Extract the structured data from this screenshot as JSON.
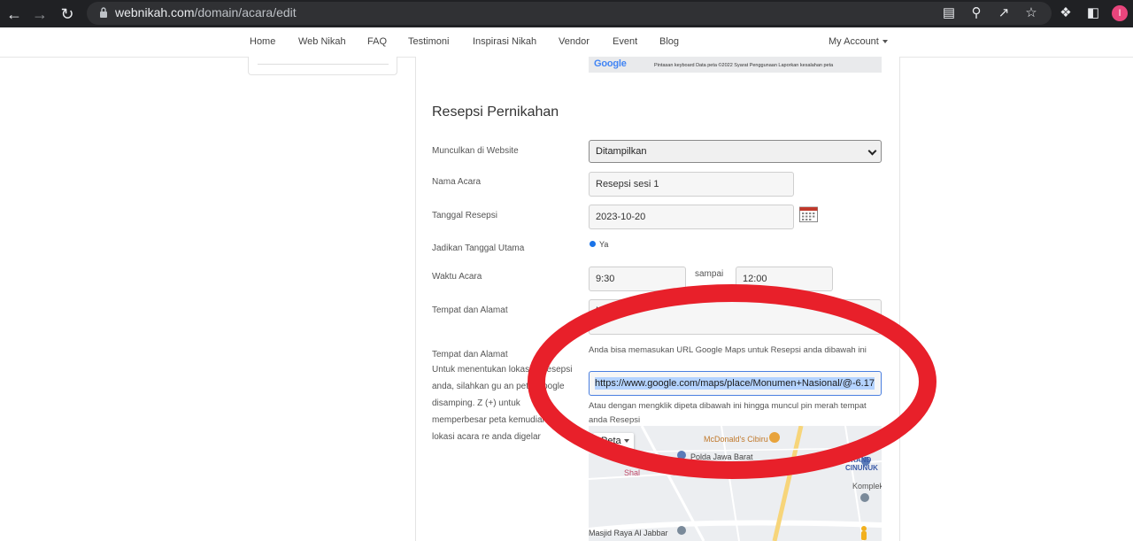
{
  "browser": {
    "url_domain": "webnikah.com",
    "url_path": "/domain/acara/edit",
    "profile_initial": "I",
    "profile_color": "#e8457c"
  },
  "navbar": {
    "items": [
      {
        "label": "Home"
      },
      {
        "label": "Web Nikah"
      },
      {
        "label": "FAQ"
      },
      {
        "label": "Testimoni"
      },
      {
        "label": "Inspirasi Nikah"
      },
      {
        "label": "Vendor"
      },
      {
        "label": "Event"
      },
      {
        "label": "Blog"
      }
    ],
    "account_label": "My Account"
  },
  "map_top": {
    "logo": "Google",
    "attribution": "Pintasan keyboard   Data peta ©2022   Syarat Penggunaan   Laporkan kesalahan peta"
  },
  "form": {
    "section_title": "Resepsi Pernikahan",
    "show_on_website": {
      "label": "Munculkan di Website",
      "value": "Ditampilkan"
    },
    "event_name": {
      "label": "Nama Acara",
      "value": "Resepsi sesi 1"
    },
    "reception_date": {
      "label": "Tanggal Resepsi",
      "value": "2023-10-20"
    },
    "main_date": {
      "label": "Jadikan Tanggal Utama",
      "option": "Ya"
    },
    "event_time": {
      "label": "Waktu Acara",
      "start": "9:30",
      "separator": "sampai",
      "end": "12:00"
    },
    "venue": {
      "label": "Tempat dan Alamat",
      "value": "Hotel I"
    },
    "venue_map": {
      "label": "Tempat dan Alamat",
      "help_text": "Untuk menentukan lokasi      at resepsi anda, silahkan gu      an peta Google disamping. Z      (+) untuk memperbesar peta kemudian klik lokasi acara re      anda digelar",
      "hint_url": "Anda bisa memasukan URL Google Maps untuk Resepsi anda dibawah ini",
      "url_value": "https://www.google.com/maps/place/Monumen+Nasional/@-6.17",
      "hint_click": "Atau dengan mengklik dipeta dibawah ini hingga muncul pin merah tempat anda Resepsi"
    }
  },
  "map_bottom": {
    "type_button": "Peta",
    "places": [
      "McDonald's Cibiru",
      "Polda Jawa Barat",
      "Shal",
      "GRAND CINUNUK",
      "Komplek",
      "Masjid Raya Al Jabbar"
    ]
  },
  "annotation": {
    "color": "#e8202a"
  }
}
